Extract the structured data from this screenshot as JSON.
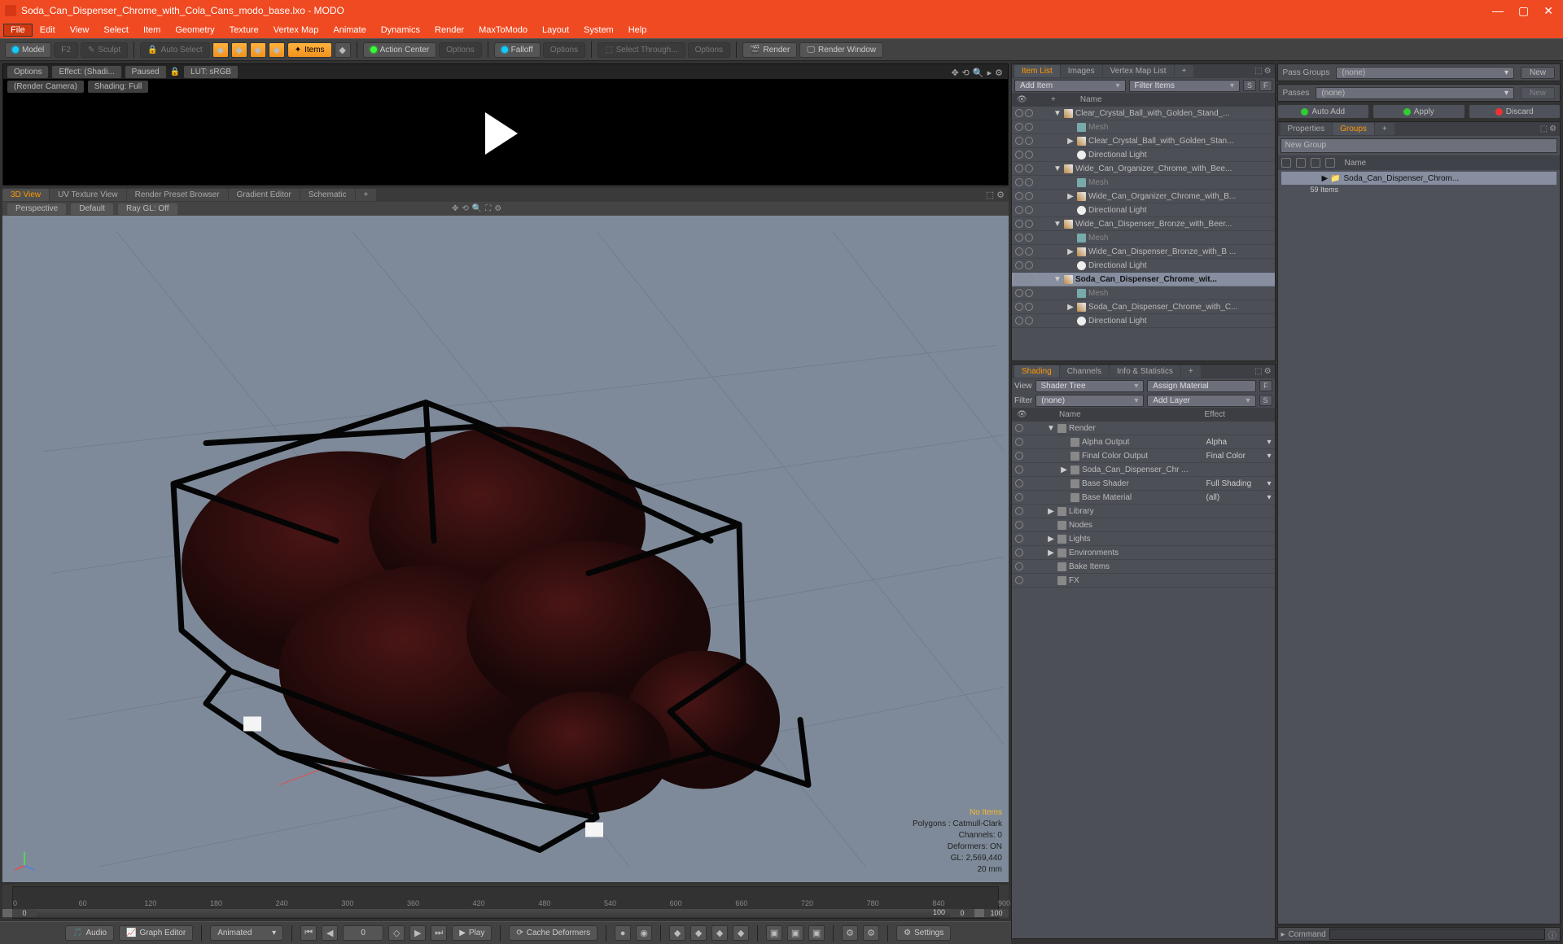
{
  "title": "Soda_Can_Dispenser_Chrome_with_Cola_Cans_modo_base.lxo - MODO",
  "menus": [
    "File",
    "Edit",
    "View",
    "Select",
    "Item",
    "Geometry",
    "Texture",
    "Vertex Map",
    "Animate",
    "Dynamics",
    "Render",
    "MaxToModo",
    "Layout",
    "System",
    "Help"
  ],
  "menu_active": "File",
  "toolbar": {
    "model": "Model",
    "sculpt": "Sculpt",
    "autosel": "Auto Select",
    "items": "Items",
    "action": "Action Center",
    "options1": "Options",
    "falloff": "Falloff",
    "options2": "Options",
    "selthrough": "Select Through...",
    "options3": "Options",
    "render": "Render",
    "rwindow": "Render Window"
  },
  "preview": {
    "options": "Options",
    "effect": "Effect: (Shadi...",
    "paused": "Paused",
    "lut": "LUT: sRGB",
    "camera": "(Render Camera)",
    "shading": "Shading: Full"
  },
  "vp_tabs": [
    "3D View",
    "UV Texture View",
    "Render Preset Browser",
    "Gradient Editor",
    "Schematic",
    "+"
  ],
  "vp_bar": {
    "persp": "Perspective",
    "def": "Default",
    "ray": "Ray GL: Off"
  },
  "vp_stats": {
    "noitems": "No Items",
    "poly": "Polygons : Catmull-Clark",
    "chan": "Channels: 0",
    "def": "Deformers: ON",
    "gl": "GL: 2,569,440",
    "mm": "20 mm"
  },
  "timeline": {
    "ticks": [
      "0",
      "60",
      "120",
      "180",
      "240",
      "300",
      "360",
      "420",
      "480",
      "540",
      "600",
      "660",
      "720",
      "780",
      "840",
      "900"
    ],
    "bar": [
      "0",
      "100",
      "0",
      "100"
    ]
  },
  "bottom": {
    "audio": "Audio",
    "graph": "Graph Editor",
    "animated": "Animated",
    "current": "0",
    "play": "Play",
    "cache": "Cache Deformers",
    "settings": "Settings"
  },
  "itemlist": {
    "tabs": [
      "Item List",
      "Images",
      "Vertex Map List",
      "+"
    ],
    "add": "Add Item",
    "filter": "Filter Items",
    "name_h": "Name",
    "rows": [
      {
        "d": 1,
        "exp": "▼",
        "i": "g",
        "t": "Clear_Crystal_Ball_with_Golden_Stand_..."
      },
      {
        "d": 2,
        "exp": "",
        "i": "m",
        "t": "Mesh",
        "dim": true
      },
      {
        "d": 2,
        "exp": "▶",
        "i": "g",
        "t": "Clear_Crystal_Ball_with_Golden_Stan..."
      },
      {
        "d": 2,
        "exp": "",
        "i": "l",
        "t": "Directional Light"
      },
      {
        "d": 1,
        "exp": "▼",
        "i": "g",
        "t": "Wide_Can_Organizer_Chrome_with_Bee..."
      },
      {
        "d": 2,
        "exp": "",
        "i": "m",
        "t": "Mesh",
        "dim": true
      },
      {
        "d": 2,
        "exp": "▶",
        "i": "g",
        "t": "Wide_Can_Organizer_Chrome_with_B..."
      },
      {
        "d": 2,
        "exp": "",
        "i": "l",
        "t": "Directional Light"
      },
      {
        "d": 1,
        "exp": "▼",
        "i": "g",
        "t": "Wide_Can_Dispenser_Bronze_with_Beer..."
      },
      {
        "d": 2,
        "exp": "",
        "i": "m",
        "t": "Mesh",
        "dim": true
      },
      {
        "d": 2,
        "exp": "▶",
        "i": "g",
        "t": "Wide_Can_Dispenser_Bronze_with_B ..."
      },
      {
        "d": 2,
        "exp": "",
        "i": "l",
        "t": "Directional Light"
      },
      {
        "d": 1,
        "exp": "▼",
        "i": "g",
        "t": "Soda_Can_Dispenser_Chrome_wit...",
        "sel": true,
        "bold": true
      },
      {
        "d": 2,
        "exp": "",
        "i": "m",
        "t": "Mesh",
        "dim": true
      },
      {
        "d": 2,
        "exp": "▶",
        "i": "g",
        "t": "Soda_Can_Dispenser_Chrome_with_C..."
      },
      {
        "d": 2,
        "exp": "",
        "i": "l",
        "t": "Directional Light"
      }
    ]
  },
  "shading": {
    "tabs": [
      "Shading",
      "Channels",
      "Info & Statistics",
      "+"
    ],
    "view": "View",
    "shader_tree": "Shader Tree",
    "assign": "Assign Material",
    "filter": "Filter",
    "none": "(none)",
    "addlayer": "Add Layer",
    "name_h": "Name",
    "effect_h": "Effect",
    "rows": [
      {
        "d": 0,
        "exp": "▼",
        "i": "r",
        "t": "Render",
        "eff": ""
      },
      {
        "d": 1,
        "exp": "",
        "i": "o",
        "t": "Alpha Output",
        "eff": "Alpha"
      },
      {
        "d": 1,
        "exp": "",
        "i": "o",
        "t": "Final Color Output",
        "eff": "Final Color"
      },
      {
        "d": 1,
        "exp": "▶",
        "i": "m",
        "t": "Soda_Can_Dispenser_Chr  ...",
        "eff": ""
      },
      {
        "d": 1,
        "exp": "",
        "i": "s",
        "t": "Base Shader",
        "eff": "Full Shading"
      },
      {
        "d": 1,
        "exp": "",
        "i": "b",
        "t": "Base Material",
        "eff": "(all)"
      },
      {
        "d": 0,
        "exp": "▶",
        "i": "f",
        "t": "Library",
        "eff": ""
      },
      {
        "d": 0,
        "exp": "",
        "i": "n",
        "t": "Nodes",
        "eff": ""
      },
      {
        "d": 0,
        "exp": "▶",
        "i": "",
        "t": "Lights",
        "eff": ""
      },
      {
        "d": 0,
        "exp": "▶",
        "i": "",
        "t": "Environments",
        "eff": ""
      },
      {
        "d": 0,
        "exp": "",
        "i": "",
        "t": "Bake Items",
        "eff": ""
      },
      {
        "d": 0,
        "exp": "",
        "i": "fx",
        "t": "FX",
        "eff": ""
      }
    ]
  },
  "passes": {
    "pg": "Pass Groups",
    "none": "(none)",
    "new": "New",
    "passes": "Passes"
  },
  "actions": {
    "auto": "Auto Add",
    "apply": "Apply",
    "discard": "Discard"
  },
  "groups": {
    "tabs": [
      "Properties",
      "Groups",
      "+"
    ],
    "input": "New Group",
    "name_h": "Name",
    "item": "Soda_Can_Dispenser_Chrom...",
    "count": "59 Items"
  },
  "cmd": {
    "label": "Command"
  }
}
